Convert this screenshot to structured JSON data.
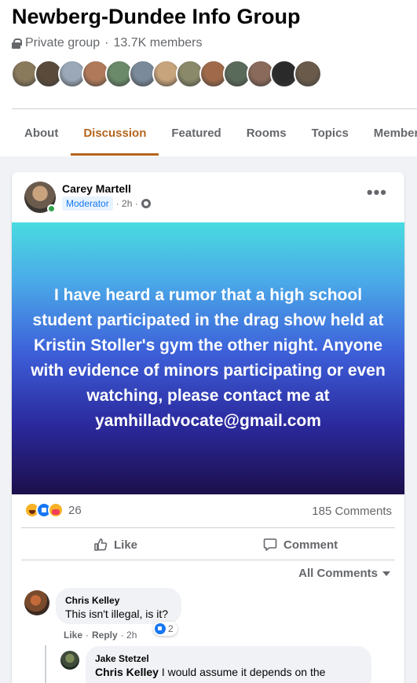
{
  "group": {
    "title": "Newberg-Dundee Info Group",
    "privacy": "Private group",
    "separator": "·",
    "members": "13.7K members",
    "member_avatars": [
      "#8a7a5c",
      "#5a4a3a",
      "#9aa8b8",
      "#b07a5a",
      "#6a8a6a",
      "#7a8a9a",
      "#c8a47c",
      "#8a8a6a",
      "#a06a4a",
      "#5a6a5a",
      "#8a6a5a",
      "#2a2a2a",
      "#6a5a4a"
    ]
  },
  "tabs": [
    {
      "label": "About",
      "active": false
    },
    {
      "label": "Discussion",
      "active": true
    },
    {
      "label": "Featured",
      "active": false
    },
    {
      "label": "Rooms",
      "active": false
    },
    {
      "label": "Topics",
      "active": false
    },
    {
      "label": "Members",
      "active": false
    }
  ],
  "colors": {
    "accent": "#b5651d",
    "link_blue": "#1877f2",
    "online": "#31a24c"
  },
  "post": {
    "author": "Carey Martell",
    "badge": "Moderator",
    "time": "· 2h ·",
    "more": "•••",
    "text": "I have heard a rumor that a high school student participated in the drag show held at Kristin Stoller's gym the other night. Anyone with evidence of minors participating or even watching, please contact me at yamhilladvocate@gmail.com",
    "reaction_count": "26",
    "comment_count": "185 Comments",
    "like_label": "Like",
    "comment_label": "Comment",
    "sort_label": "All Comments"
  },
  "comments": [
    {
      "author": "Chris Kelley",
      "text": "This isn't illegal, is it?",
      "like": "Like",
      "dot": "·",
      "reply": "Reply",
      "time": "· 2h",
      "reaction_count": "2"
    },
    {
      "author": "Jake Stetzel",
      "mention": "Chris Kelley",
      "text": " I would assume it depends on the"
    }
  ]
}
